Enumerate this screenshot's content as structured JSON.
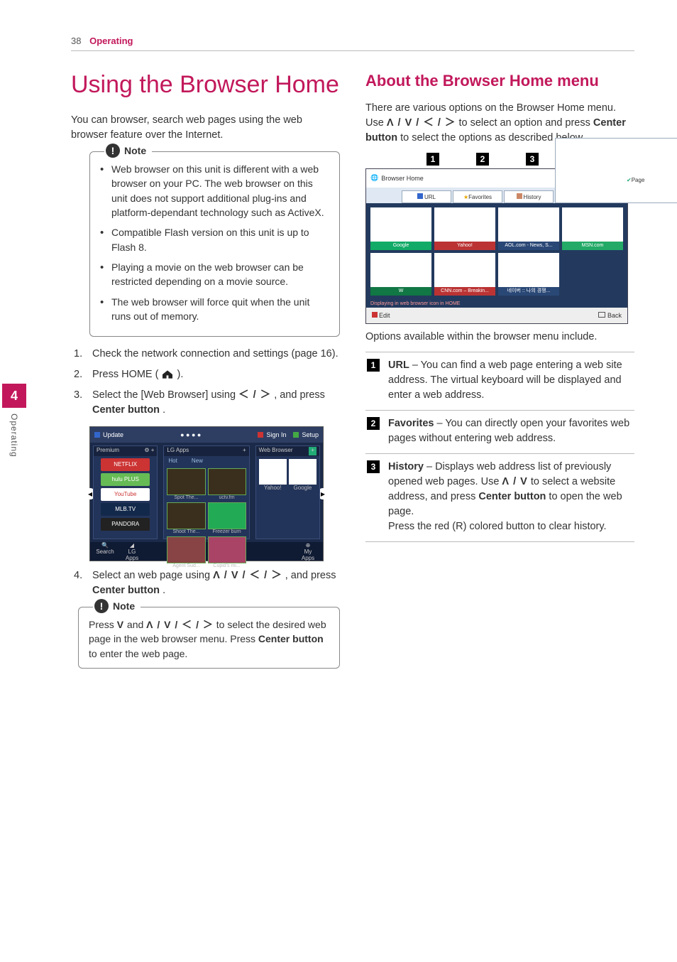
{
  "header": {
    "page_number": "38",
    "section": "Operating"
  },
  "sidetab": {
    "num": "4",
    "label": "Operating"
  },
  "left": {
    "title": "Using the Browser Home",
    "intro": "You can browser, search web pages using the web browser feature over the Internet.",
    "note1_label": "Note",
    "note1": [
      "Web browser on this unit is different with a web browser on your PC. The web browser on this unit does not support additional plug-ins and platform-dependant technology such as ActiveX.",
      "Compatible Flash version on this unit is up to Flash 8.",
      "Playing a movie on the web browser can be restricted depending on a movie source.",
      "The web browser will force quit when the unit runs out of memory."
    ],
    "steps": {
      "s1": "Check the network connection and settings (page 16).",
      "s2_a": "Press HOME (",
      "s2_b": ").",
      "s3_a": "Select the [Web Browser] using ",
      "s3_arrows": "＜ / ＞",
      "s3_b": ", and press ",
      "s3_c": "Center button",
      "s3_d": ".",
      "s4_a": "Select an web page using ",
      "s4_arrows": "Λ / ⅴ / ＜ / ＞",
      "s4_arrows_disp": "Λ / V / ＜ / ＞",
      "s4_b": ", and press ",
      "s4_c": "Center button",
      "s4_d": "."
    },
    "note2_label": "Note",
    "note2_a": "Press ",
    "note2_v": "V",
    "note2_b": " and ",
    "note2_arrows": "Λ / V / ＜ / ＞",
    "note2_c": " to select the desired web page in the web browser menu. Press ",
    "note2_d": "Center button",
    "note2_e": " to enter the web page.",
    "shot": {
      "top_update": "Update",
      "top_signin": "Sign In",
      "top_setup": "Setup",
      "premium": "Premium",
      "lgapps": "LG Apps",
      "wb": "Web Browser",
      "p_netflix": "NETFLIX",
      "p_hulu": "hulu PLUS",
      "p_yt": "YouTube",
      "p_mlb": "MLB.TV",
      "p_pand": "PANDORA",
      "a_new": "New",
      "a_hot": "Hot",
      "a_spot": "Spot The...",
      "a_uctv": "uctv.fm",
      "a_shoot": "Shoot The...",
      "a_fb": "Freezer burn",
      "a_agent": "Agent Sud...",
      "a_cupid": "Cupid's mi...",
      "w_yahoo": "Yahoo!",
      "w_google": "Google",
      "bot_search": "Search",
      "bot_lg": "LG Apps",
      "bot_my": "My Apps"
    }
  },
  "right": {
    "title": "About the Browser Home menu",
    "intro_a": "There are various options on the Browser Home menu. Use ",
    "intro_arrows": "Λ / V / ＜ / ＞",
    "intro_b": " to select an option and press ",
    "intro_c": "Center button",
    "intro_d": " to select the options as described below.",
    "shot": {
      "bh": "Browser Home",
      "url": "URL",
      "fav": "Favorites",
      "hist": "History",
      "page": "Page",
      "g": "Google",
      "y": "Yahoo!",
      "aol": "AOL.com - News, S...",
      "msn": "MSN.com",
      "w": "W",
      "cnn": "CNN.com – Breakin...",
      "kor": "네이버 :: 나의 경쟁...",
      "edit": "Edit",
      "back": "Back",
      "hint": "Displaying in web browser icon in HOME"
    },
    "caption": "Options available within the browser menu include.",
    "opts": {
      "n1": "1",
      "t1": "URL",
      "d1": " – You can find a web page entering a web site address. The virtual keyboard will be displayed and enter a web address.",
      "n2": "2",
      "t2": "Favorites",
      "d2": " – You can directly open your favorites web pages without entering web address.",
      "n3": "3",
      "t3": "History",
      "d3a": " – Displays web address list of previously opened web pages. Use ",
      "d3arrows": "Λ / V",
      "d3b": " to select a website address, and press ",
      "d3c": "Center button",
      "d3d": " to open the web page.",
      "d3e": "Press the red (R) colored button to clear history."
    }
  }
}
